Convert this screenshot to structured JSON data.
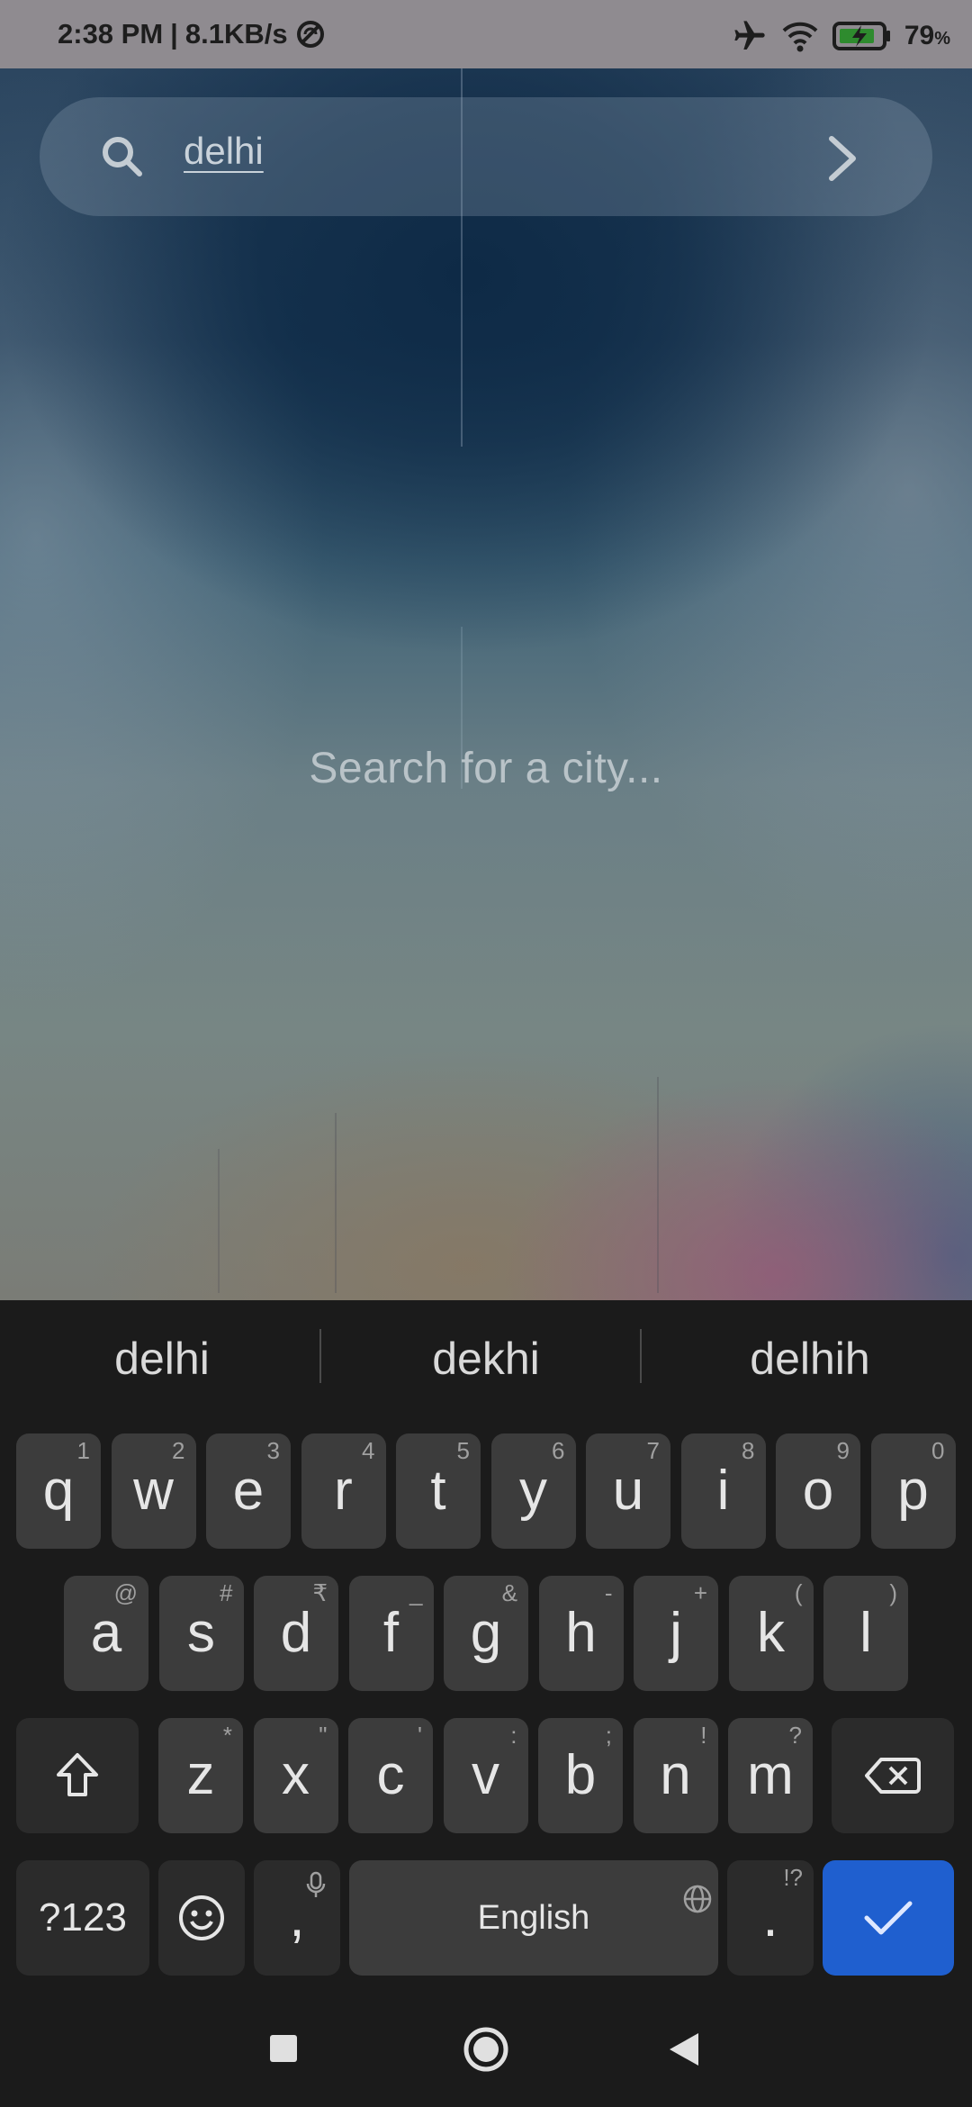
{
  "status_bar": {
    "time": "2:38 PM",
    "separator": "|",
    "network_speed": "8.1KB/s",
    "battery_level": "79",
    "battery_unit": "%",
    "icons": [
      "do-not-disturb-icon",
      "airplane-mode-icon",
      "wifi-icon",
      "battery-charging-icon"
    ]
  },
  "search": {
    "query": "delhi",
    "empty_hint": "Search for a city..."
  },
  "keyboard": {
    "suggestions": [
      "delhi",
      "dekhi",
      "delhih"
    ],
    "row1": [
      {
        "k": "q",
        "h": "1"
      },
      {
        "k": "w",
        "h": "2"
      },
      {
        "k": "e",
        "h": "3"
      },
      {
        "k": "r",
        "h": "4"
      },
      {
        "k": "t",
        "h": "5"
      },
      {
        "k": "y",
        "h": "6"
      },
      {
        "k": "u",
        "h": "7"
      },
      {
        "k": "i",
        "h": "8"
      },
      {
        "k": "o",
        "h": "9"
      },
      {
        "k": "p",
        "h": "0"
      }
    ],
    "row2": [
      {
        "k": "a",
        "h": "@"
      },
      {
        "k": "s",
        "h": "#"
      },
      {
        "k": "d",
        "h": "₹"
      },
      {
        "k": "f",
        "h": "_"
      },
      {
        "k": "g",
        "h": "&"
      },
      {
        "k": "h",
        "h": "-"
      },
      {
        "k": "j",
        "h": "+"
      },
      {
        "k": "k",
        "h": "("
      },
      {
        "k": "l",
        "h": ")"
      }
    ],
    "row3": [
      {
        "k": "z",
        "h": "*"
      },
      {
        "k": "x",
        "h": "\""
      },
      {
        "k": "c",
        "h": "'"
      },
      {
        "k": "v",
        "h": ":"
      },
      {
        "k": "b",
        "h": ";"
      },
      {
        "k": "n",
        "h": "!"
      },
      {
        "k": "m",
        "h": "?"
      }
    ],
    "symbols_label": "?123",
    "comma": ",",
    "space_label": "English",
    "period": ".",
    "period_hint": "!?"
  },
  "colors": {
    "enter_key": "#1f5fcf",
    "keyboard_bg": "#1b1b1b",
    "key_bg": "#3c3c3c",
    "status_bar_bg": "#8f8b90"
  }
}
